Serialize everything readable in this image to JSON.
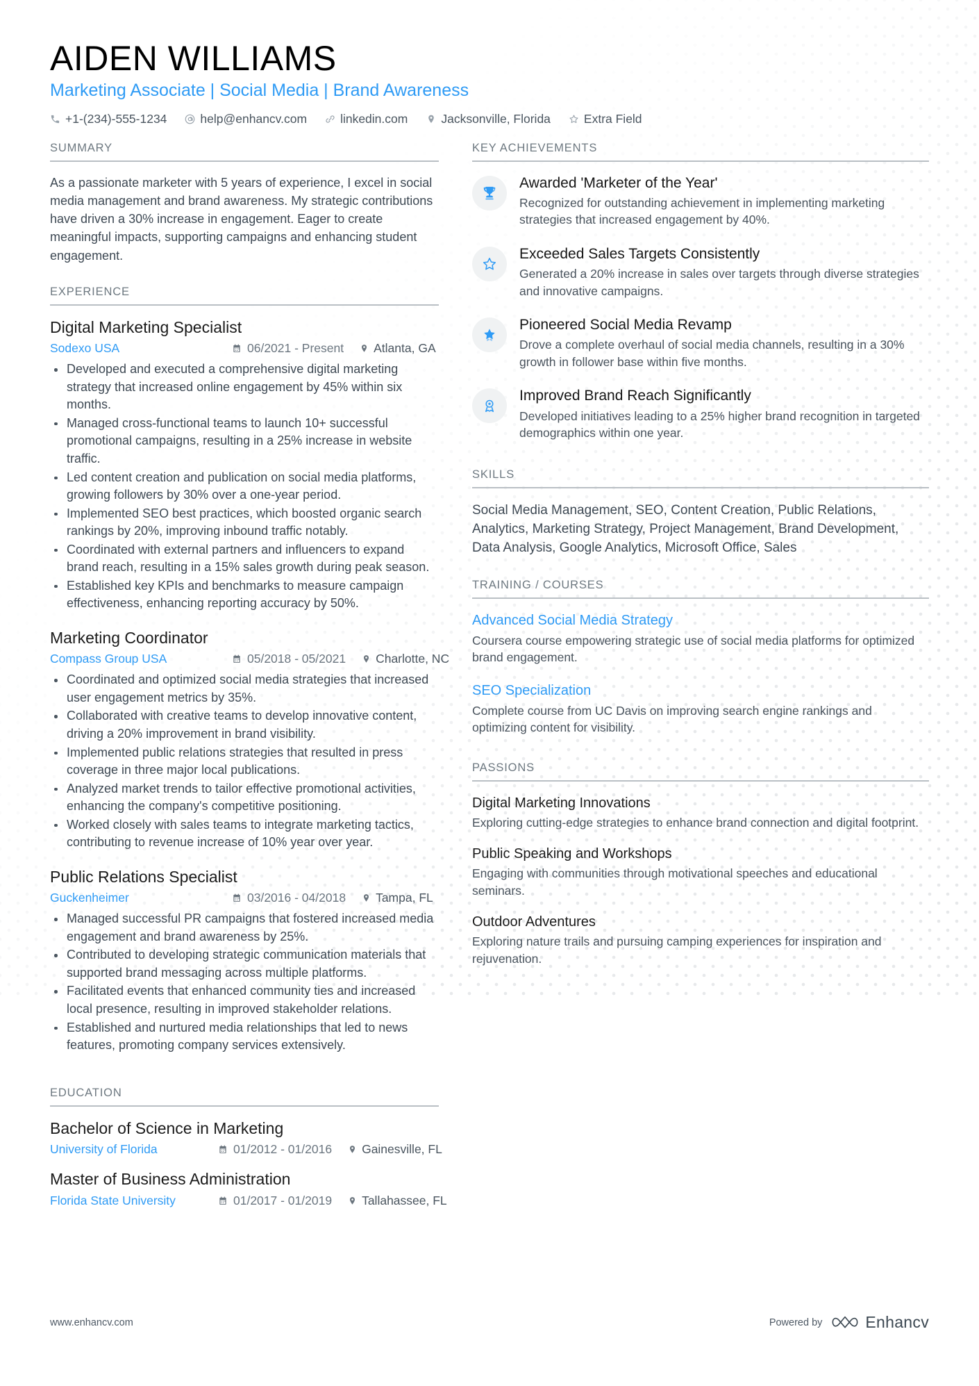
{
  "header": {
    "name": "AIDEN WILLIAMS",
    "title": "Marketing Associate | Social Media | Brand Awareness",
    "accent_color": "#2f9bf5",
    "contacts": [
      {
        "icon": "phone-icon",
        "text": "+1-(234)-555-1234"
      },
      {
        "icon": "email-icon",
        "text": "help@enhancv.com"
      },
      {
        "icon": "link-icon",
        "text": "linkedin.com"
      },
      {
        "icon": "location-pin-icon",
        "text": "Jacksonville, Florida"
      },
      {
        "icon": "star-icon",
        "text": "Extra Field"
      }
    ]
  },
  "summary": {
    "heading": "SUMMARY",
    "text": "As a passionate marketer with 5 years of experience, I excel in social media management and brand awareness. My strategic contributions have driven a 30% increase in engagement. Eager to create meaningful impacts, supporting campaigns and enhancing student engagement."
  },
  "experience": {
    "heading": "EXPERIENCE",
    "entries": [
      {
        "title": "Digital Marketing Specialist",
        "org": "Sodexo USA",
        "date": "06/2021 - Present",
        "location": "Atlanta, GA",
        "bullets": [
          "Developed and executed a comprehensive digital marketing strategy that increased online engagement by 45% within six months.",
          "Managed cross-functional teams to launch 10+ successful promotional campaigns, resulting in a 25% increase in website traffic.",
          "Led content creation and publication on social media platforms, growing followers by 30% over a one-year period.",
          "Implemented SEO best practices, which boosted organic search rankings by 20%, improving inbound traffic notably.",
          "Coordinated with external partners and influencers to expand brand reach, resulting in a 15% sales growth during peak season.",
          "Established key KPIs and benchmarks to measure campaign effectiveness, enhancing reporting accuracy by 50%."
        ]
      },
      {
        "title": "Marketing Coordinator",
        "org": "Compass Group USA",
        "date": "05/2018 - 05/2021",
        "location": "Charlotte, NC",
        "bullets": [
          "Coordinated and optimized social media strategies that increased user engagement metrics by 35%.",
          "Collaborated with creative teams to develop innovative content, driving a 20% improvement in brand visibility.",
          "Implemented public relations strategies that resulted in press coverage in three major local publications.",
          "Analyzed market trends to tailor effective promotional activities, enhancing the company's competitive positioning.",
          "Worked closely with sales teams to integrate marketing tactics, contributing to revenue increase of 10% year over year."
        ]
      },
      {
        "title": "Public Relations Specialist",
        "org": "Guckenheimer",
        "date": "03/2016 - 04/2018",
        "location": "Tampa, FL",
        "bullets": [
          "Managed successful PR campaigns that fostered increased media engagement and brand awareness by 25%.",
          "Contributed to developing strategic communication materials that supported brand messaging across multiple platforms.",
          "Facilitated events that enhanced community ties and increased local presence, resulting in improved stakeholder relations.",
          "Established and nurtured media relationships that led to news features, promoting company services extensively."
        ]
      }
    ]
  },
  "education": {
    "heading": "EDUCATION",
    "entries": [
      {
        "title": "Bachelor of Science in Marketing",
        "org": "University of Florida",
        "date": "01/2012 - 01/2016",
        "location": "Gainesville, FL"
      },
      {
        "title": "Master of Business Administration",
        "org": "Florida State University",
        "date": "01/2017 - 01/2019",
        "location": "Tallahassee, FL"
      }
    ]
  },
  "key_achievements": {
    "heading": "KEY ACHIEVEMENTS",
    "items": [
      {
        "icon": "trophy-icon",
        "title": "Awarded 'Marketer of the Year'",
        "desc": "Recognized for outstanding achievement in implementing marketing strategies that increased engagement by 40%."
      },
      {
        "icon": "star-outline-icon",
        "title": "Exceeded Sales Targets Consistently",
        "desc": "Generated a 20% increase in sales over targets through diverse strategies and innovative campaigns."
      },
      {
        "icon": "star-badge-icon",
        "title": "Pioneered Social Media Revamp",
        "desc": "Drove a complete overhaul of social media channels, resulting in a 30% growth in follower base within five months."
      },
      {
        "icon": "award-medal-icon",
        "title": "Improved Brand Reach Significantly",
        "desc": "Developed initiatives leading to a 25% higher brand recognition in targeted demographics within one year."
      }
    ]
  },
  "skills": {
    "heading": "SKILLS",
    "text": "Social Media Management, SEO, Content Creation, Public Relations, Analytics, Marketing Strategy, Project Management, Brand Development, Data Analysis, Google Analytics, Microsoft Office, Sales"
  },
  "training": {
    "heading": "TRAINING / COURSES",
    "items": [
      {
        "title": "Advanced Social Media Strategy",
        "desc": "Coursera course empowering strategic use of social media platforms for optimized brand engagement."
      },
      {
        "title": "SEO Specialization",
        "desc": "Complete course from UC Davis on improving search engine rankings and optimizing content for visibility."
      }
    ]
  },
  "passions": {
    "heading": "PASSIONS",
    "items": [
      {
        "title": "Digital Marketing Innovations",
        "desc": "Exploring cutting-edge strategies to enhance brand connection and digital footprint."
      },
      {
        "title": "Public Speaking and Workshops",
        "desc": "Engaging with communities through motivational speeches and educational seminars."
      },
      {
        "title": "Outdoor Adventures",
        "desc": "Exploring nature trails and pursuing camping experiences for inspiration and rejuvenation."
      }
    ]
  },
  "footer": {
    "url": "www.enhancv.com",
    "powered_by_label": "Powered by",
    "brand_name": "Enhancv"
  }
}
